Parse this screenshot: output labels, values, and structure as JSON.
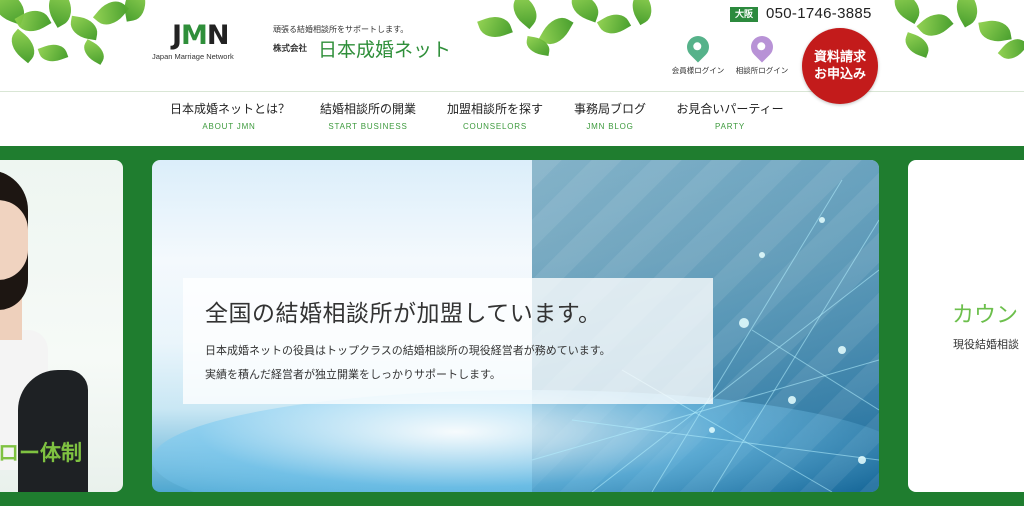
{
  "header": {
    "logo_text": "JMN",
    "logo_sub": "Japan Marriage Network",
    "tagline": "頑張る結婚相談所をサポートします。",
    "company_prefix": "株式会社",
    "company_name": "日本成婚ネット",
    "region_badge": "大阪",
    "phone": "050-1746-3885",
    "member_login": "会員様ログイン",
    "agency_login": "相談所ログイン",
    "cta_line1": "資料請求",
    "cta_line2": "お申込み",
    "colors": {
      "brand_green": "#2f8f3a",
      "cta_red": "#c31b1b"
    }
  },
  "nav": {
    "items": [
      {
        "jp": "日本成婚ネットとは？",
        "en": "ABOUT JMN"
      },
      {
        "jp": "結婚相談所の開業",
        "en": "START BUSINESS"
      },
      {
        "jp": "加盟相談所を探す",
        "en": "COUNSELORS"
      },
      {
        "jp": "事務局ブログ",
        "en": "JMN BLOG"
      },
      {
        "jp": "お見合いパーティー",
        "en": "PARTY"
      }
    ]
  },
  "slider": {
    "left_caption": "ロー体制",
    "main": {
      "title": "全国の結婚相談所が加盟しています。",
      "line1": "日本成婚ネットの役員はトップクラスの結婚相談所の現役経営者が務めています。",
      "line2": "実績を積んだ経営者が独立開業をしっかりサポートします。"
    },
    "right_title": "カウン",
    "right_sub": "現役結婚相談"
  }
}
